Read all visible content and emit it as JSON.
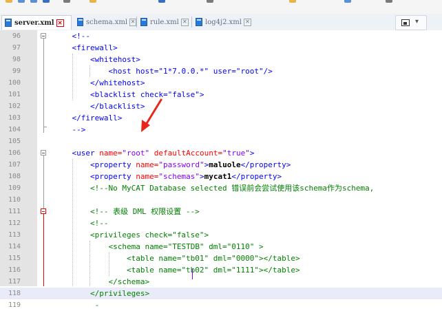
{
  "tabs": [
    {
      "name": "server.xml",
      "active": true
    },
    {
      "name": "schema.xml",
      "active": false
    },
    {
      "name": "rule.xml",
      "active": false
    },
    {
      "name": "log4j2.xml",
      "active": false
    }
  ],
  "tab_close_glyph": "✕",
  "menu": {
    "chevron": "▾"
  },
  "lines": [
    {
      "num": "96",
      "segs": [
        [
          "plain",
          "    "
        ],
        [
          "tag",
          "<!--"
        ]
      ]
    },
    {
      "num": "97",
      "segs": [
        [
          "plain",
          "    "
        ],
        [
          "tag",
          "<firewall>"
        ]
      ]
    },
    {
      "num": "98",
      "segs": [
        [
          "plain",
          "        "
        ],
        [
          "tag",
          "<whitehost>"
        ]
      ]
    },
    {
      "num": "99",
      "segs": [
        [
          "plain",
          "            "
        ],
        [
          "tag",
          "<host host=\"1*7.0.0.*\" user=\"root\"/>"
        ]
      ]
    },
    {
      "num": "100",
      "segs": [
        [
          "plain",
          "        "
        ],
        [
          "tag",
          "</whitehost>"
        ]
      ]
    },
    {
      "num": "101",
      "segs": [
        [
          "plain",
          "        "
        ],
        [
          "tag",
          "<blacklist check=\"false\">"
        ]
      ]
    },
    {
      "num": "102",
      "segs": [
        [
          "plain",
          "        "
        ],
        [
          "tag",
          "</blacklist>"
        ]
      ]
    },
    {
      "num": "103",
      "segs": [
        [
          "plain",
          "    "
        ],
        [
          "tag",
          "</firewall>"
        ]
      ]
    },
    {
      "num": "104",
      "segs": [
        [
          "plain",
          "    "
        ],
        [
          "tag",
          "-->"
        ]
      ]
    },
    {
      "num": "105",
      "segs": []
    },
    {
      "num": "106",
      "segs": [
        [
          "plain",
          "    "
        ],
        [
          "tag",
          "<user "
        ],
        [
          "attr",
          "name="
        ],
        [
          "val",
          "\"root\" "
        ],
        [
          "attr",
          "defaultAccount="
        ],
        [
          "val",
          "\"true\""
        ],
        [
          "tag",
          ">"
        ]
      ]
    },
    {
      "num": "107",
      "segs": [
        [
          "plain",
          "        "
        ],
        [
          "tag",
          "<property "
        ],
        [
          "attr",
          "name="
        ],
        [
          "val",
          "\"password\""
        ],
        [
          "tag",
          ">"
        ],
        [
          "text",
          "maluole"
        ],
        [
          "tag",
          "</property>"
        ]
      ]
    },
    {
      "num": "108",
      "segs": [
        [
          "plain",
          "        "
        ],
        [
          "tag",
          "<property "
        ],
        [
          "attr",
          "name="
        ],
        [
          "val",
          "\"schemas\""
        ],
        [
          "tag",
          ">"
        ],
        [
          "text",
          "mycat1"
        ],
        [
          "tag",
          "</property>"
        ]
      ]
    },
    {
      "num": "109",
      "segs": [
        [
          "plain",
          "        "
        ],
        [
          "comment",
          "<!--No MyCAT Database selected 错误前会尝试使用该schema作为schema,"
        ]
      ]
    },
    {
      "num": "110",
      "segs": []
    },
    {
      "num": "111",
      "segs": [
        [
          "plain",
          "        "
        ],
        [
          "comment",
          "<!-- 表级 DML 权限设置 -->"
        ]
      ]
    },
    {
      "num": "112",
      "segs": [
        [
          "plain",
          "        "
        ],
        [
          "comment",
          "<!--"
        ]
      ]
    },
    {
      "num": "113",
      "segs": [
        [
          "plain",
          "        "
        ],
        [
          "comment",
          "<privileges check=\"false\">"
        ]
      ]
    },
    {
      "num": "114",
      "segs": [
        [
          "plain",
          "            "
        ],
        [
          "comment",
          "<schema name=\"TESTDB\" dml=\"0110\" >"
        ]
      ]
    },
    {
      "num": "115",
      "segs": [
        [
          "plain",
          "                "
        ],
        [
          "comment",
          "<table name=\"tb01\" dml=\"0000\"></table>"
        ]
      ]
    },
    {
      "num": "116",
      "segs": [
        [
          "plain",
          "                "
        ],
        [
          "comment",
          "<table name=\"tb02\" dml=\"1111\"></table>"
        ]
      ]
    },
    {
      "num": "117",
      "segs": [
        [
          "plain",
          "            "
        ],
        [
          "comment",
          "</schema>"
        ]
      ]
    },
    {
      "num": "118",
      "segs": [
        [
          "plain",
          "        "
        ],
        [
          "comment",
          "</privileges>"
        ]
      ],
      "current": true
    },
    {
      "num": "119",
      "segs": [
        [
          "plain",
          "         "
        ],
        [
          "comment",
          "-"
        ]
      ]
    }
  ],
  "colors": {
    "tag": "#0000ff",
    "attr": "#ff0000",
    "val": "#8000ff",
    "comment": "#008000",
    "arrow": "#e8261c"
  }
}
